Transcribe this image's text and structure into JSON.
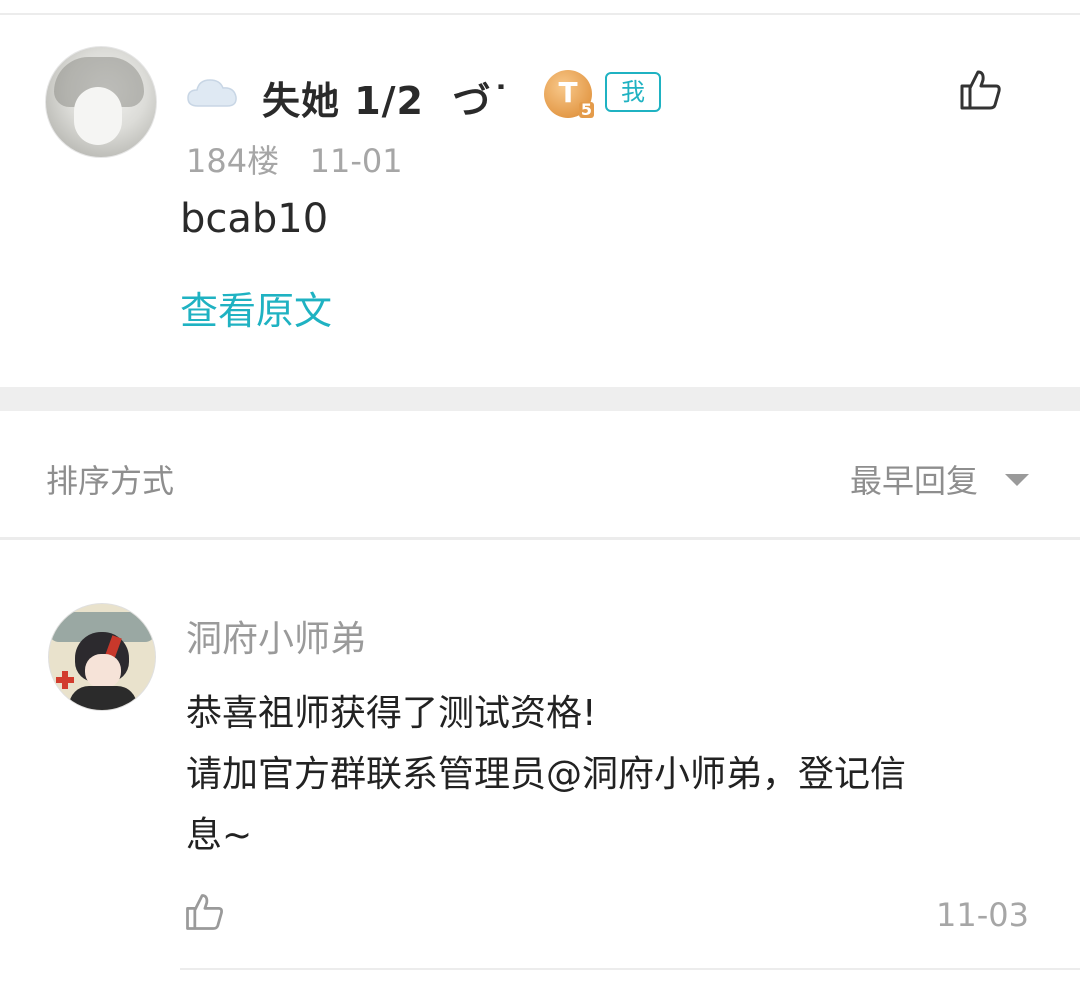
{
  "post": {
    "author_name": "失她 1/2  づ˙",
    "level_badge": "T",
    "level_sub": "5",
    "me_tag": "我",
    "meta": "184楼   11-01",
    "content": "bcab10",
    "view_original": "查看原文",
    "avatar_icon": "user-avatar",
    "cloud_icon": "cloud-icon",
    "like_icon": "thumbs-up-icon"
  },
  "sort": {
    "label": "排序方式",
    "value": "最早回复"
  },
  "reply": {
    "author": "洞府小师弟",
    "line1": "恭喜祖师获得了测试资格!",
    "line2": "请加官方群联系管理员@洞府小师弟，登记信",
    "line3": "息~",
    "date": "11-03",
    "like_icon": "thumbs-up-icon"
  },
  "colors": {
    "accent": "#1fb2c2",
    "muted_text": "#a6a6a6",
    "band": "#eeeeee",
    "badge": "#e49b4a"
  }
}
